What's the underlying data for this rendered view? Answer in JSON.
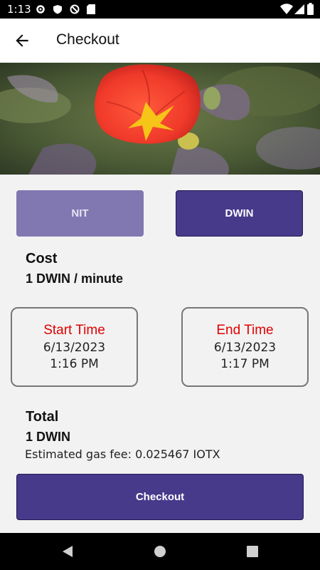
{
  "status_bar": {
    "time": "1:13",
    "left_icons": [
      "gear-icon",
      "shield-icon",
      "blocked-icon",
      "sd-card-icon"
    ],
    "right_icons": [
      "wifi-icon",
      "signal-icon",
      "battery-icon"
    ]
  },
  "header": {
    "title": "Checkout",
    "back_icon": "arrow-back-icon"
  },
  "hero": {
    "description_icon": "flower-image"
  },
  "token_toggle": {
    "nit_label": "NIT",
    "dwin_label": "DWIN",
    "selected": "DWIN"
  },
  "cost": {
    "heading": "Cost",
    "value": "1 DWIN / minute"
  },
  "start_time": {
    "label": "Start Time",
    "date": "6/13/2023",
    "time": "1:16 PM"
  },
  "end_time": {
    "label": "End Time",
    "date": "6/13/2023",
    "time": "1:17 PM"
  },
  "total": {
    "heading": "Total",
    "value": "1 DWIN",
    "gas_fee": "Estimated gas fee: 0.025467 IOTX"
  },
  "checkout_button": {
    "label": "Checkout"
  },
  "nav_bar": {
    "icons": [
      "back-triangle-icon",
      "home-circle-icon",
      "recents-square-icon"
    ]
  },
  "colors": {
    "primary": "#473a8b",
    "primary_light": "#8178b1",
    "accent_red": "#e00000",
    "background": "#f2f2f2"
  }
}
